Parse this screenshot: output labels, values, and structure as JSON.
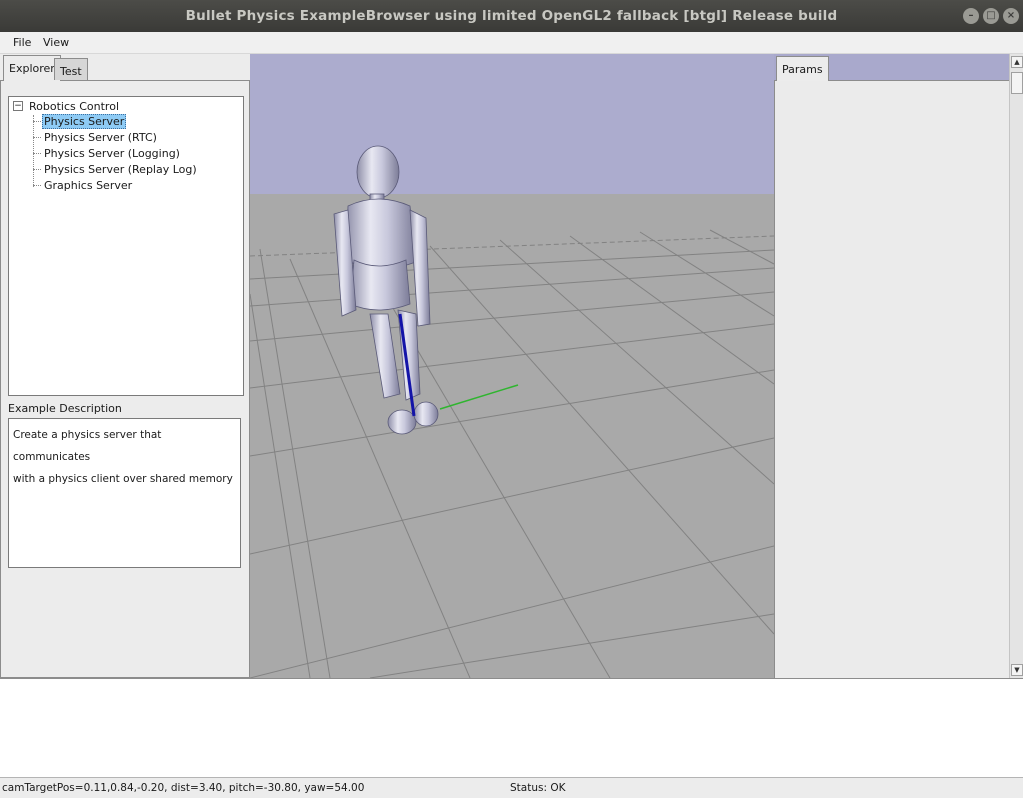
{
  "window": {
    "title": "Bullet Physics ExampleBrowser using limited OpenGL2 fallback [btgl] Release build"
  },
  "menubar": {
    "file": "File",
    "view": "View"
  },
  "left_tabs": {
    "explorer": "Explorer",
    "test": "Test"
  },
  "tree": {
    "root": "Robotics Control",
    "expander_symbol": "⊟",
    "items": [
      {
        "label": "Physics Server",
        "selected": true
      },
      {
        "label": "Physics Server (RTC)"
      },
      {
        "label": "Physics Server (Logging)"
      },
      {
        "label": "Physics Server (Replay Log)"
      },
      {
        "label": "Graphics Server"
      }
    ]
  },
  "description": {
    "label": "Example Description",
    "lines": [
      "Create a physics server that communicates",
      "with a physics client over shared memory"
    ]
  },
  "right_tabs": {
    "params": "Params"
  },
  "status": {
    "camera": "camTargetPos=0.11,0.84,-0.20, dist=3.40, pitch=-30.80, yaw=54.00",
    "state": "Status: OK"
  },
  "colors": {
    "sky": "#acacce",
    "ground": "#a9a9a9",
    "selection": "#8ecbf5",
    "axis_z": "#1414a8",
    "axis_x": "#2fb52f"
  }
}
